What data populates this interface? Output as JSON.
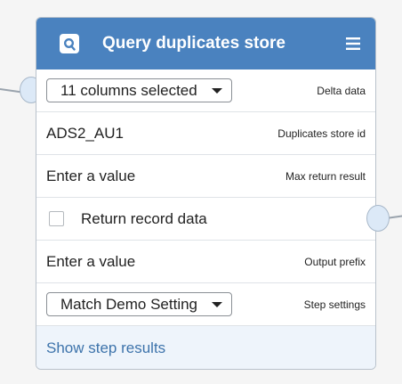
{
  "node": {
    "title": "Query duplicates store",
    "icon": "query-magnifier-icon",
    "menu_icon": "hamburger-menu-icon",
    "colors": {
      "header": "#4a82bf",
      "footer_bg": "#eef4fb",
      "link": "#3d73ab"
    }
  },
  "rows": {
    "delta_data": {
      "select_value": "11 columns selected",
      "label": "Delta data"
    },
    "duplicates_store_id": {
      "value": "ADS2_AU1",
      "label": "Duplicates store id"
    },
    "max_return_result": {
      "value": "Enter a value",
      "label": "Max return result"
    },
    "return_record_data": {
      "label": "Return record data",
      "checked": false
    },
    "output_prefix": {
      "value": "Enter a value",
      "label": "Output prefix"
    },
    "step_settings": {
      "select_value": "Match Demo Setting",
      "label": "Step settings"
    }
  },
  "footer": {
    "link_label": "Show step results"
  }
}
